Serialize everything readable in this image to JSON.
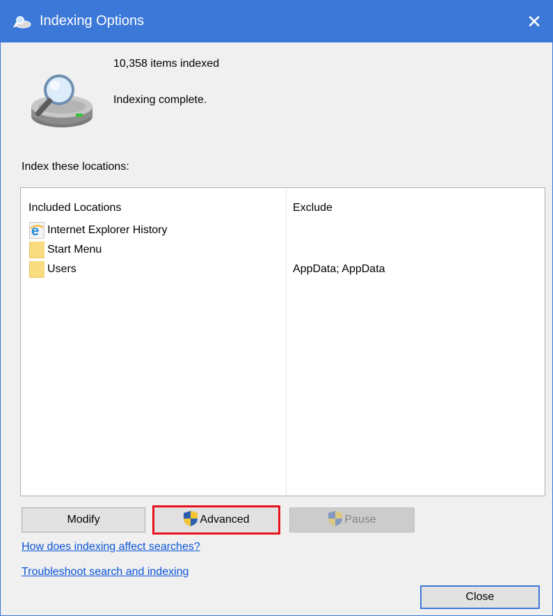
{
  "window": {
    "title": "Indexing Options",
    "title_icon": "indexing-icon",
    "close_icon": "close-icon",
    "close_glyph": "✕",
    "accent_color": "#3c78d8"
  },
  "status": {
    "items_indexed": "10,358 items indexed",
    "message": "Indexing complete."
  },
  "locations": {
    "label": "Index these locations:",
    "headers": {
      "included": "Included Locations",
      "exclude": "Exclude"
    },
    "rows": [
      {
        "name": "Internet Explorer History",
        "exclude": "",
        "icon": "internet-explorer-icon"
      },
      {
        "name": "Start Menu",
        "exclude": "",
        "icon": "folder-icon"
      },
      {
        "name": "Users",
        "exclude": "AppData; AppData",
        "icon": "folder-icon"
      }
    ]
  },
  "buttons": {
    "modify": "Modify",
    "advanced": "Advanced",
    "pause": "Pause",
    "close": "Close",
    "highlight_color": "#e8121a"
  },
  "links": {
    "how": "How does indexing affect searches?",
    "troubleshoot": "Troubleshoot search and indexing",
    "color": "#0a54d6"
  }
}
